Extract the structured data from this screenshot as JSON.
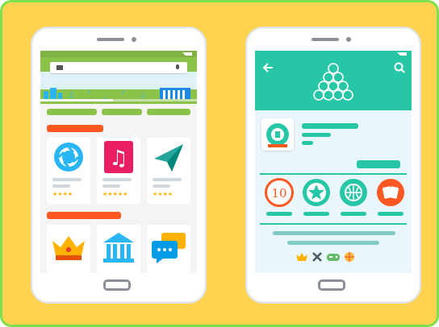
{
  "colors": {
    "background": "#ffd24f",
    "frame_border": "#7ee04a",
    "store_green": "#8bc34a",
    "store_accent": "#ff5722",
    "teal": "#26c6a6",
    "app_bg": "#e9f6fb",
    "star": "#ffb300"
  },
  "left_phone": {
    "search_bar": {
      "menu_icon": "hamburger-icon",
      "mic_icon": "mic-icon"
    },
    "apps_row1": [
      {
        "icon": "camera-shutter-icon",
        "stars": "★★★★"
      },
      {
        "icon": "music-note-icon",
        "stars": "★★★★★"
      },
      {
        "icon": "paper-plane-icon",
        "stars": "★★★★"
      }
    ],
    "apps_row2": [
      {
        "icon": "crown-icon"
      },
      {
        "icon": "bank-building-icon"
      },
      {
        "icon": "chat-bubbles-icon"
      }
    ]
  },
  "right_phone": {
    "header": {
      "back_icon": "back-arrow-icon",
      "search_icon": "search-icon",
      "logo_icon": "billiard-balls-icon"
    },
    "app_icon": "billiard-ball-icon",
    "badges": [
      {
        "icon": "ten-badge-icon",
        "text": "10"
      },
      {
        "icon": "star-badge-icon",
        "text": ""
      },
      {
        "icon": "basketball-badge-icon",
        "text": ""
      },
      {
        "icon": "cards-badge-icon",
        "text": ""
      }
    ],
    "bottom_icons": [
      "crown-icon",
      "swords-icon",
      "gamepad-icon",
      "basketball-icon"
    ]
  }
}
